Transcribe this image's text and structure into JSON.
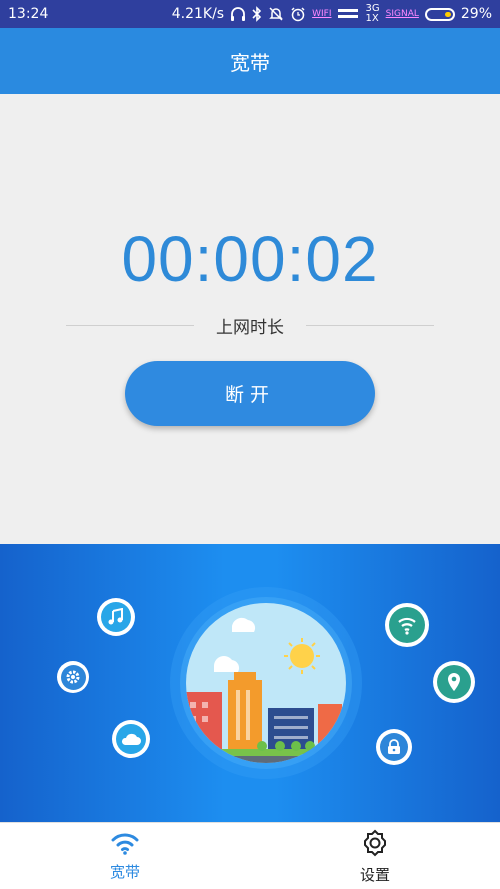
{
  "status_bar": {
    "time": "13:24",
    "speed": "4.21K/s",
    "wifi_label": "WIFI",
    "network_3g": "3G",
    "network_1x": "1X",
    "signal_label": "SIGNAL",
    "battery": "29%",
    "icons": [
      "headphones-icon",
      "bluetooth-icon",
      "mute-icon",
      "alarm-icon"
    ]
  },
  "header": {
    "title": "宽带"
  },
  "main": {
    "timer": "00:00:02",
    "timer_caption": "上网时长",
    "disconnect_label": "断开"
  },
  "illustration": {
    "icons": [
      "music-icon",
      "settings-icon",
      "cloud-icon",
      "wifi-icon",
      "location-icon",
      "lock-icon"
    ]
  },
  "bottom_nav": {
    "tabs": [
      {
        "label": "宽带",
        "icon": "wifi-icon",
        "active": true
      },
      {
        "label": "设置",
        "icon": "gear-icon",
        "active": false
      }
    ]
  },
  "colors": {
    "status_bar": "#2f3f9e",
    "title_bar": "#2a8ae0",
    "accent": "#2e8ad8",
    "illustration_bg": "#1d8ef0"
  }
}
